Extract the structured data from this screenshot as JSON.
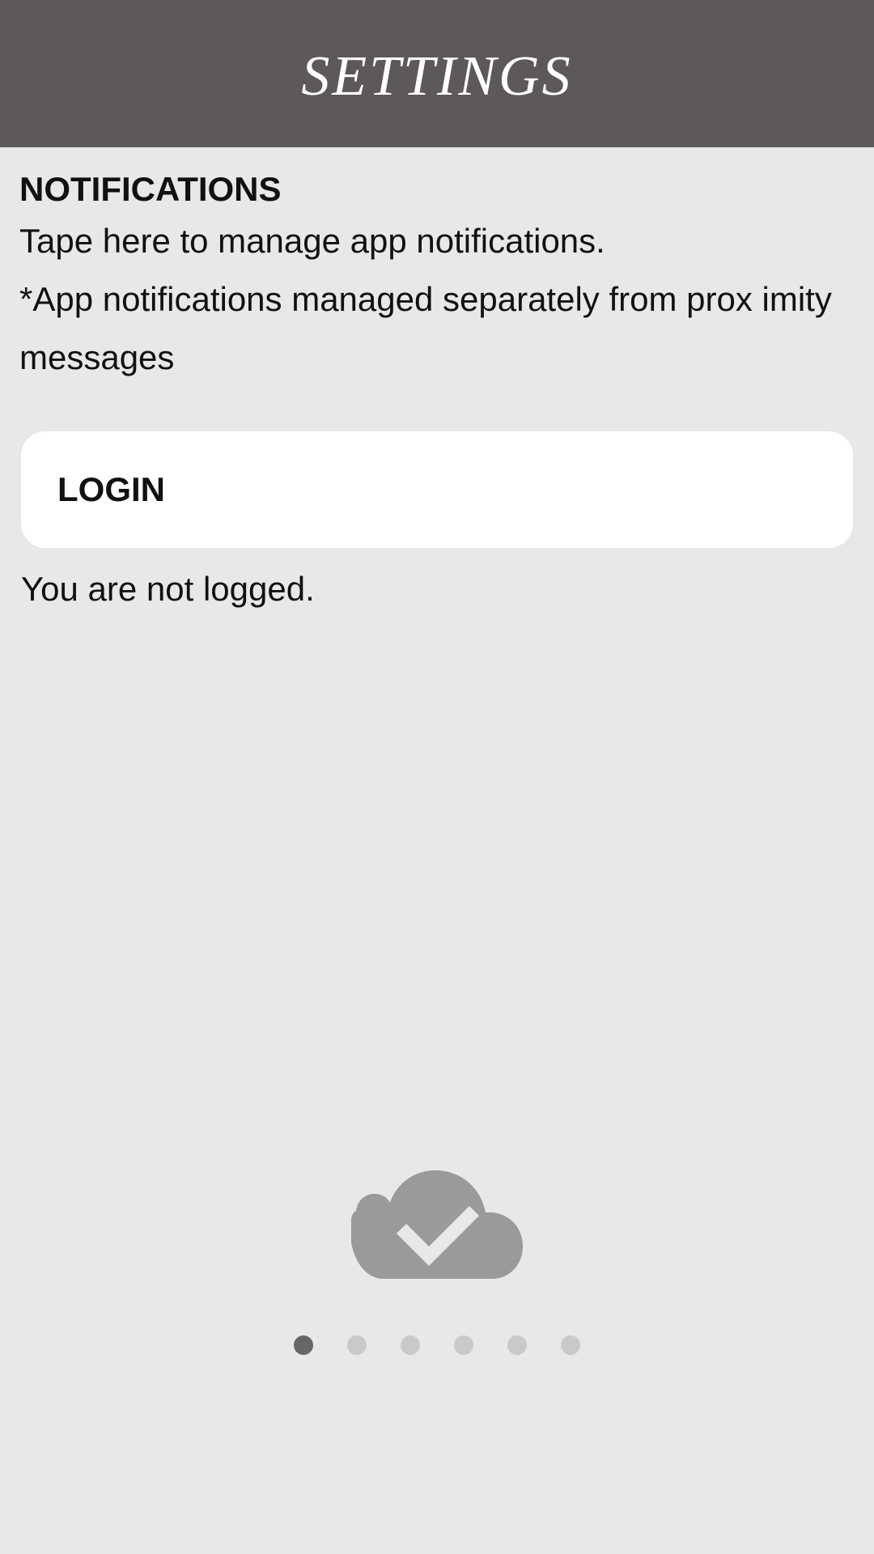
{
  "header": {
    "title": "SETTINGS"
  },
  "notifications": {
    "title": "NOTIFICATIONS",
    "line1": "Tape here to manage app notifications.",
    "line2": "*App notifications managed separately from prox imity messages"
  },
  "login": {
    "button_label": "LOGIN",
    "status": "You are not logged."
  },
  "footer": {
    "cloud_icon": "cloud-check-icon",
    "pager": {
      "total": 6,
      "active_index": 0
    }
  },
  "colors": {
    "header_bg": "#5d5958",
    "page_bg": "#e8e8e8",
    "card_bg": "#ffffff",
    "icon": "#9a999b",
    "dot_active": "#666666",
    "dot_inactive": "#c9c9c9"
  }
}
